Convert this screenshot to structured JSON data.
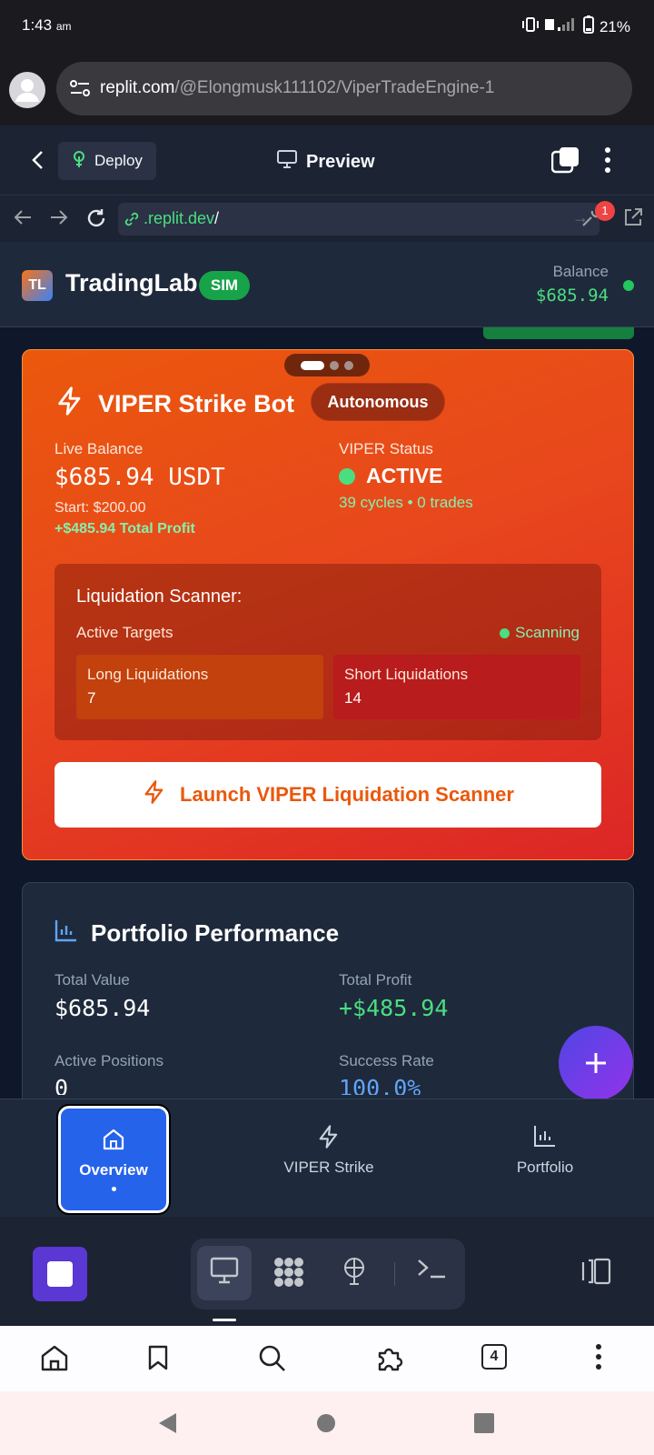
{
  "status_bar": {
    "time": "1:43",
    "ampm": "am",
    "battery": "21%"
  },
  "browser": {
    "url_host": "replit.com",
    "url_path": "/@Elongmusk111102/ViperTradeEngine-1",
    "tabs_count": "4"
  },
  "replit": {
    "deploy_label": "Deploy",
    "preview_label": "Preview",
    "preview_url_host": ".replit.dev",
    "preview_url_path": "/",
    "devtools_badge": "1"
  },
  "app": {
    "logo": "TL",
    "title": "TradingLab",
    "mode_badge": "SIM",
    "balance_label": "Balance",
    "balance_value": "$685.94"
  },
  "viper_card": {
    "title": "VIPER Strike Bot",
    "badge": "Autonomous",
    "live_balance_label": "Live Balance",
    "live_balance_value": "$685.94 USDT",
    "start_text": "Start: $200.00",
    "profit_text": "+$485.94 Total Profit",
    "status_label": "VIPER Status",
    "status_value": "ACTIVE",
    "cycles_text": "39 cycles • 0 trades",
    "scanner": {
      "title": "Liquidation Scanner:",
      "subtitle": "Active Targets",
      "state": "Scanning",
      "long_label": "Long Liquidations",
      "long_value": "7",
      "short_label": "Short Liquidations",
      "short_value": "14"
    },
    "launch_button": "Launch VIPER Liquidation Scanner"
  },
  "portfolio": {
    "title": "Portfolio Performance",
    "total_value_label": "Total Value",
    "total_value": "$685.94",
    "total_profit_label": "Total Profit",
    "total_profit": "+$485.94",
    "positions_label": "Active Positions",
    "positions_value": "0",
    "success_label": "Success Rate",
    "success_value": "100.0%"
  },
  "tabs": [
    {
      "label": "Overview"
    },
    {
      "label": "VIPER Strike"
    },
    {
      "label": "Portfolio"
    }
  ],
  "colors": {
    "accent_orange": "#ea580c",
    "accent_green": "#4ade80",
    "accent_blue": "#2563eb",
    "fab_purple": "#7c3aed"
  }
}
